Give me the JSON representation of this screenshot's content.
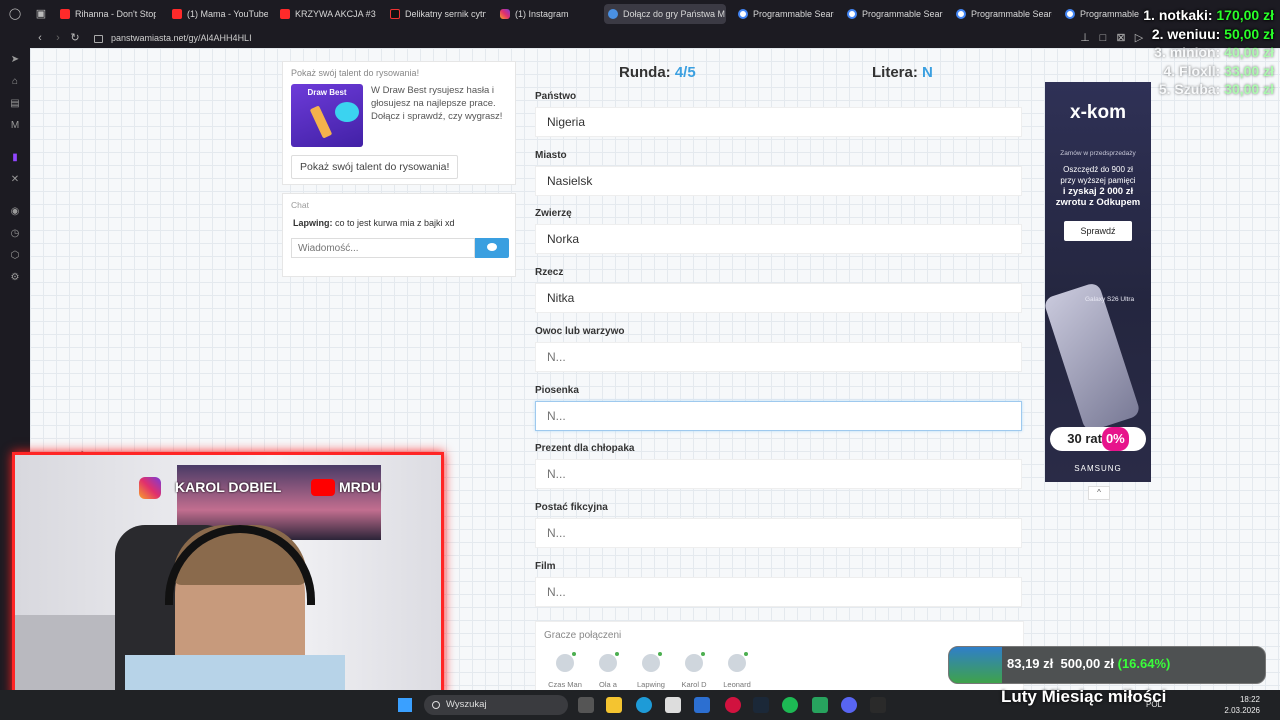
{
  "browser": {
    "tabs": [
      {
        "label": "Rihanna - Don't Stop",
        "favicon": "youtube-icon"
      },
      {
        "label": "(1) Mama - YouTube",
        "favicon": "youtube-icon"
      },
      {
        "label": "KRZYWA AKCJA #31",
        "favicon": "youtube-icon"
      },
      {
        "label": "Delikatny sernik cytry",
        "favicon": "tiktok-icon"
      },
      {
        "label": "(1) Instagram",
        "favicon": "instagram-icon"
      },
      {
        "label": "Dołącz do gry Państwa M",
        "favicon": "panstwa-miasta-icon"
      },
      {
        "label": "Programmable Searc",
        "favicon": "google-icon"
      },
      {
        "label": "Programmable Searc",
        "favicon": "google-icon"
      },
      {
        "label": "Programmable Searc",
        "favicon": "google-icon"
      },
      {
        "label": "Programmable S",
        "favicon": "google-icon"
      }
    ],
    "active_tab": 5,
    "url": "panstwamiasta.net/gy/Al4AHH4HLI"
  },
  "promo": {
    "title": "Pokaż swój talent do rysowania!",
    "image_text": "Draw Best",
    "text": "W Draw Best rysujesz hasła i głosujesz na najlepsze prace. Dołącz i sprawdź, czy wygrasz!",
    "button": "Pokaż swój talent do rysowania!"
  },
  "chat": {
    "label": "Chat",
    "messages": [
      {
        "author": "Lapwing:",
        "text": "co to jest kurwa mia z bajki xd"
      }
    ],
    "input_placeholder": "Wiadomość..."
  },
  "game": {
    "round_label": "Runda:",
    "round_value": "4/5",
    "letter_label": "Litera:",
    "letter_value": "N",
    "fields": [
      {
        "label": "Państwo",
        "value": "Nigeria",
        "placeholder": ""
      },
      {
        "label": "Miasto",
        "value": "Nasielsk",
        "placeholder": ""
      },
      {
        "label": "Zwierzę",
        "value": "Norka",
        "placeholder": ""
      },
      {
        "label": "Rzecz",
        "value": "Nitka",
        "placeholder": ""
      },
      {
        "label": "Owoc lub warzywo",
        "value": "",
        "placeholder": "N..."
      },
      {
        "label": "Piosenka",
        "value": "",
        "placeholder": "N..."
      },
      {
        "label": "Prezent dla chłopaka",
        "value": "",
        "placeholder": "N..."
      },
      {
        "label": "Postać fikcyjna",
        "value": "",
        "placeholder": "N..."
      },
      {
        "label": "Film",
        "value": "",
        "placeholder": "N..."
      }
    ],
    "focused_field": 5,
    "players_title": "Gracze połączeni",
    "players": [
      "Czas Man",
      "Ola a",
      "Lapwing",
      "Karol D",
      "Leonard"
    ]
  },
  "ad": {
    "logo": "x-kom",
    "subtitle": "Zamów w przedsprzedaży",
    "line1": "Oszczędź do 900 zł",
    "line2": "przy wyższej pamięci",
    "line3": "i zyskaj 2 000 zł",
    "line4": "zwrotu z Odkupem",
    "cta": "Sprawdź",
    "phone_name": "Galaxy S26 Ultra",
    "rate_text": "30 rat",
    "rate_value": "0%",
    "brand": "SAMSUNG"
  },
  "overlay": {
    "leaderboard": [
      {
        "name": "1. notkaki:",
        "amount": "170,00 zł"
      },
      {
        "name": "2. weniuu:",
        "amount": "50,00 zł"
      },
      {
        "name": "3. minion:",
        "amount": "40,00 zł"
      },
      {
        "name": "4. Floxll:",
        "amount": "33,00 zł"
      },
      {
        "name": "5. Szuba:",
        "amount": "30,00 zł"
      }
    ],
    "webcam_instagram": "KAROL DOBIEL",
    "webcam_youtube": "MRDU",
    "donation_current": "83,19 zł",
    "donation_goal": "500,00 zł",
    "donation_percent_text": "(16.64%)",
    "donation_fraction": 0.1664,
    "goal_title": "Luty Miesiąc miłości"
  },
  "taskbar": {
    "search_placeholder": "Wyszukaj",
    "lang": "POL",
    "time": "18:22",
    "date": "2.03.2026"
  }
}
